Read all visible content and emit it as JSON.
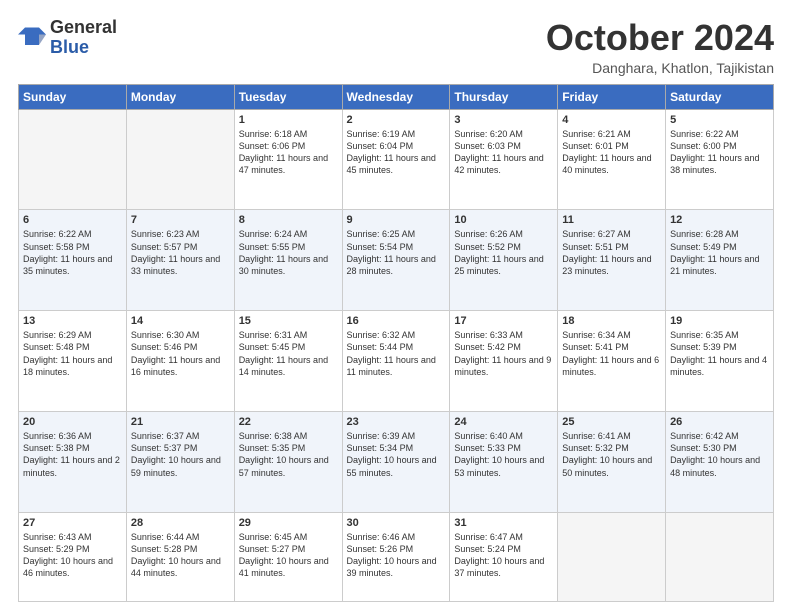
{
  "header": {
    "logo_general": "General",
    "logo_blue": "Blue",
    "month_title": "October 2024",
    "location": "Danghara, Khatlon, Tajikistan"
  },
  "days_of_week": [
    "Sunday",
    "Monday",
    "Tuesday",
    "Wednesday",
    "Thursday",
    "Friday",
    "Saturday"
  ],
  "weeks": [
    [
      {
        "day": "",
        "info": ""
      },
      {
        "day": "",
        "info": ""
      },
      {
        "day": "1",
        "info": "Sunrise: 6:18 AM\nSunset: 6:06 PM\nDaylight: 11 hours and 47 minutes."
      },
      {
        "day": "2",
        "info": "Sunrise: 6:19 AM\nSunset: 6:04 PM\nDaylight: 11 hours and 45 minutes."
      },
      {
        "day": "3",
        "info": "Sunrise: 6:20 AM\nSunset: 6:03 PM\nDaylight: 11 hours and 42 minutes."
      },
      {
        "day": "4",
        "info": "Sunrise: 6:21 AM\nSunset: 6:01 PM\nDaylight: 11 hours and 40 minutes."
      },
      {
        "day": "5",
        "info": "Sunrise: 6:22 AM\nSunset: 6:00 PM\nDaylight: 11 hours and 38 minutes."
      }
    ],
    [
      {
        "day": "6",
        "info": "Sunrise: 6:22 AM\nSunset: 5:58 PM\nDaylight: 11 hours and 35 minutes."
      },
      {
        "day": "7",
        "info": "Sunrise: 6:23 AM\nSunset: 5:57 PM\nDaylight: 11 hours and 33 minutes."
      },
      {
        "day": "8",
        "info": "Sunrise: 6:24 AM\nSunset: 5:55 PM\nDaylight: 11 hours and 30 minutes."
      },
      {
        "day": "9",
        "info": "Sunrise: 6:25 AM\nSunset: 5:54 PM\nDaylight: 11 hours and 28 minutes."
      },
      {
        "day": "10",
        "info": "Sunrise: 6:26 AM\nSunset: 5:52 PM\nDaylight: 11 hours and 25 minutes."
      },
      {
        "day": "11",
        "info": "Sunrise: 6:27 AM\nSunset: 5:51 PM\nDaylight: 11 hours and 23 minutes."
      },
      {
        "day": "12",
        "info": "Sunrise: 6:28 AM\nSunset: 5:49 PM\nDaylight: 11 hours and 21 minutes."
      }
    ],
    [
      {
        "day": "13",
        "info": "Sunrise: 6:29 AM\nSunset: 5:48 PM\nDaylight: 11 hours and 18 minutes."
      },
      {
        "day": "14",
        "info": "Sunrise: 6:30 AM\nSunset: 5:46 PM\nDaylight: 11 hours and 16 minutes."
      },
      {
        "day": "15",
        "info": "Sunrise: 6:31 AM\nSunset: 5:45 PM\nDaylight: 11 hours and 14 minutes."
      },
      {
        "day": "16",
        "info": "Sunrise: 6:32 AM\nSunset: 5:44 PM\nDaylight: 11 hours and 11 minutes."
      },
      {
        "day": "17",
        "info": "Sunrise: 6:33 AM\nSunset: 5:42 PM\nDaylight: 11 hours and 9 minutes."
      },
      {
        "day": "18",
        "info": "Sunrise: 6:34 AM\nSunset: 5:41 PM\nDaylight: 11 hours and 6 minutes."
      },
      {
        "day": "19",
        "info": "Sunrise: 6:35 AM\nSunset: 5:39 PM\nDaylight: 11 hours and 4 minutes."
      }
    ],
    [
      {
        "day": "20",
        "info": "Sunrise: 6:36 AM\nSunset: 5:38 PM\nDaylight: 11 hours and 2 minutes."
      },
      {
        "day": "21",
        "info": "Sunrise: 6:37 AM\nSunset: 5:37 PM\nDaylight: 10 hours and 59 minutes."
      },
      {
        "day": "22",
        "info": "Sunrise: 6:38 AM\nSunset: 5:35 PM\nDaylight: 10 hours and 57 minutes."
      },
      {
        "day": "23",
        "info": "Sunrise: 6:39 AM\nSunset: 5:34 PM\nDaylight: 10 hours and 55 minutes."
      },
      {
        "day": "24",
        "info": "Sunrise: 6:40 AM\nSunset: 5:33 PM\nDaylight: 10 hours and 53 minutes."
      },
      {
        "day": "25",
        "info": "Sunrise: 6:41 AM\nSunset: 5:32 PM\nDaylight: 10 hours and 50 minutes."
      },
      {
        "day": "26",
        "info": "Sunrise: 6:42 AM\nSunset: 5:30 PM\nDaylight: 10 hours and 48 minutes."
      }
    ],
    [
      {
        "day": "27",
        "info": "Sunrise: 6:43 AM\nSunset: 5:29 PM\nDaylight: 10 hours and 46 minutes."
      },
      {
        "day": "28",
        "info": "Sunrise: 6:44 AM\nSunset: 5:28 PM\nDaylight: 10 hours and 44 minutes."
      },
      {
        "day": "29",
        "info": "Sunrise: 6:45 AM\nSunset: 5:27 PM\nDaylight: 10 hours and 41 minutes."
      },
      {
        "day": "30",
        "info": "Sunrise: 6:46 AM\nSunset: 5:26 PM\nDaylight: 10 hours and 39 minutes."
      },
      {
        "day": "31",
        "info": "Sunrise: 6:47 AM\nSunset: 5:24 PM\nDaylight: 10 hours and 37 minutes."
      },
      {
        "day": "",
        "info": ""
      },
      {
        "day": "",
        "info": ""
      }
    ]
  ]
}
